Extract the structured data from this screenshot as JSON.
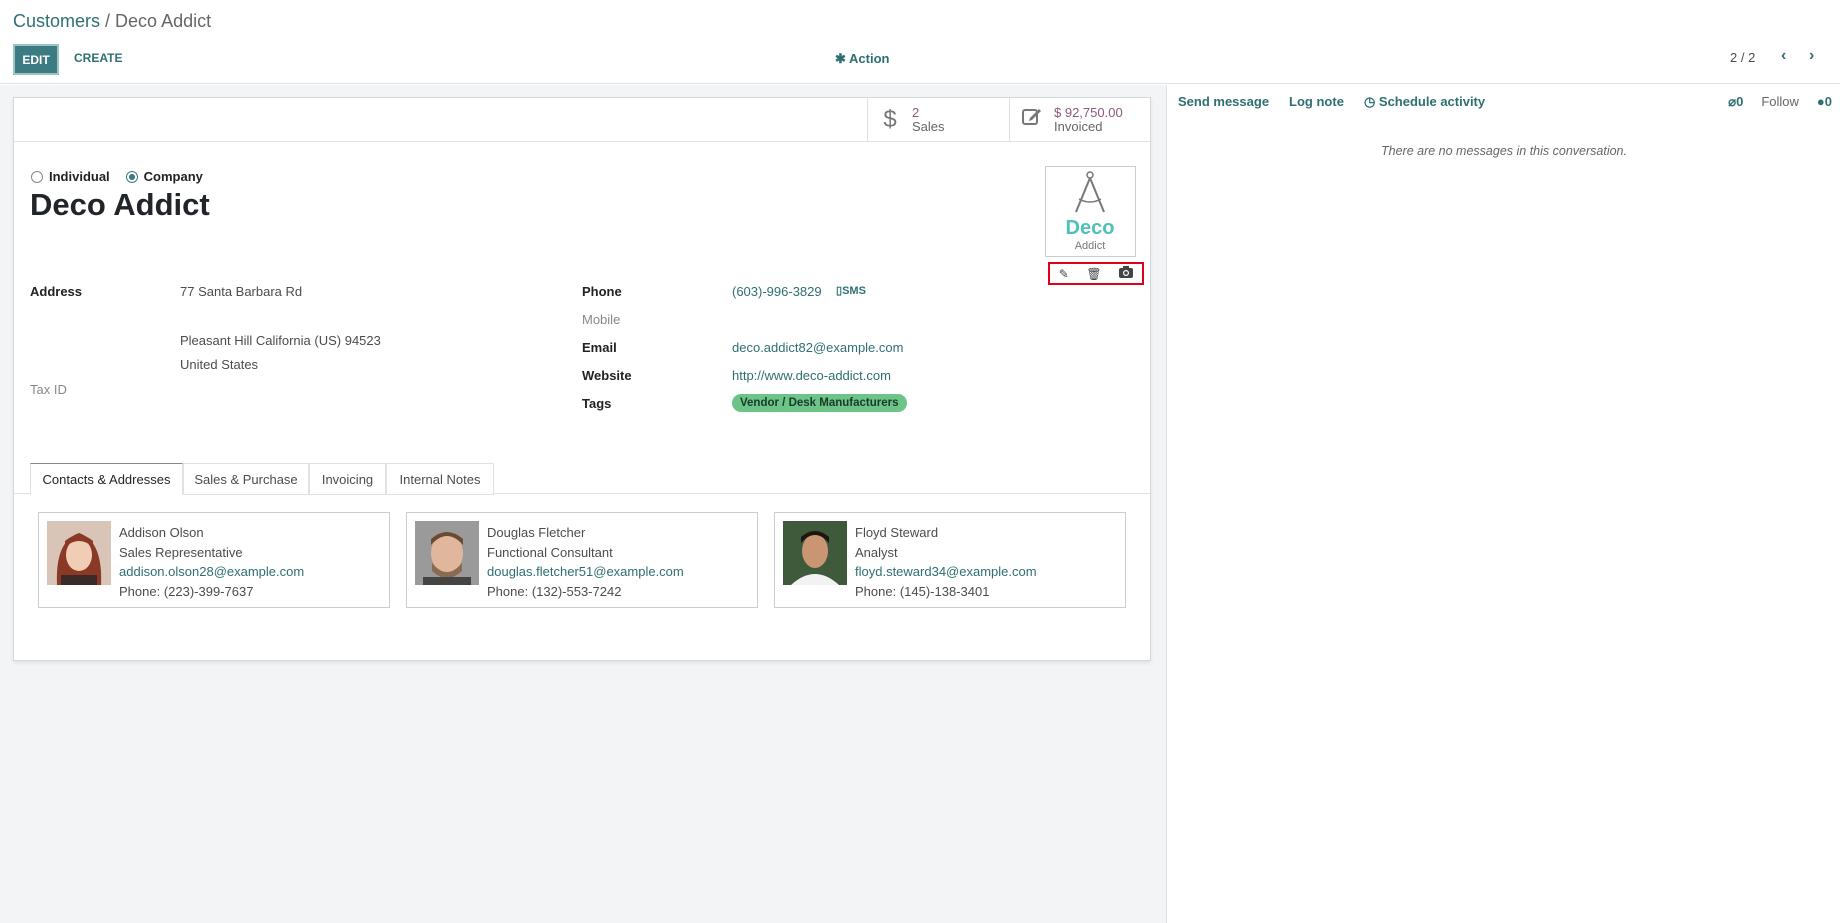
{
  "breadcrumb": {
    "parent": "Customers",
    "separator": " / ",
    "current": "Deco Addict"
  },
  "toolbar": {
    "edit_label": "EDIT",
    "create_label": "CREATE",
    "action_label": "Action"
  },
  "pager": {
    "value": "2 / 2"
  },
  "stats": {
    "sales_value": "2",
    "sales_label": "Sales",
    "invoiced_value": "$ 92,750.00",
    "invoiced_label": "Invoiced"
  },
  "company_type": {
    "individual": "Individual",
    "company": "Company",
    "selected": "company"
  },
  "partner": {
    "name": "Deco Addict",
    "logo_text": "Deco",
    "logo_sub": "Addict"
  },
  "fields": {
    "address_label": "Address",
    "street": "77 Santa Barbara Rd",
    "city_line": "Pleasant Hill  California (US)  94523",
    "country": "United States",
    "taxid_label": "Tax ID",
    "phone_label": "Phone",
    "phone": "(603)-996-3829",
    "sms_label": "SMS",
    "mobile_label": "Mobile",
    "email_label": "Email",
    "email": "deco.addict82@example.com",
    "website_label": "Website",
    "website": "http://www.deco-addict.com",
    "tags_label": "Tags",
    "tag": "Vendor / Desk Manufacturers"
  },
  "tabs": [
    "Contacts & Addresses",
    "Sales & Purchase",
    "Invoicing",
    "Internal Notes"
  ],
  "contacts": [
    {
      "name": "Addison Olson",
      "title": "Sales Representative",
      "email": "addison.olson28@example.com",
      "phone": "Phone: (223)-399-7637"
    },
    {
      "name": "Douglas Fletcher",
      "title": "Functional Consultant",
      "email": "douglas.fletcher51@example.com",
      "phone": "Phone: (132)-553-7242"
    },
    {
      "name": "Floyd Steward",
      "title": "Analyst",
      "email": "floyd.steward34@example.com",
      "phone": "Phone: (145)-138-3401"
    }
  ],
  "chatter": {
    "send_message": "Send message",
    "log_note": "Log note",
    "schedule_activity": "Schedule activity",
    "attachments_count": "0",
    "follow": "Follow",
    "followers_count": "0",
    "empty": "There are no messages in this conversation."
  },
  "colors": {
    "primary": "#3c7b82",
    "link": "#2f6f73",
    "tag": "#6cc489",
    "highlight": "#e0001b"
  }
}
